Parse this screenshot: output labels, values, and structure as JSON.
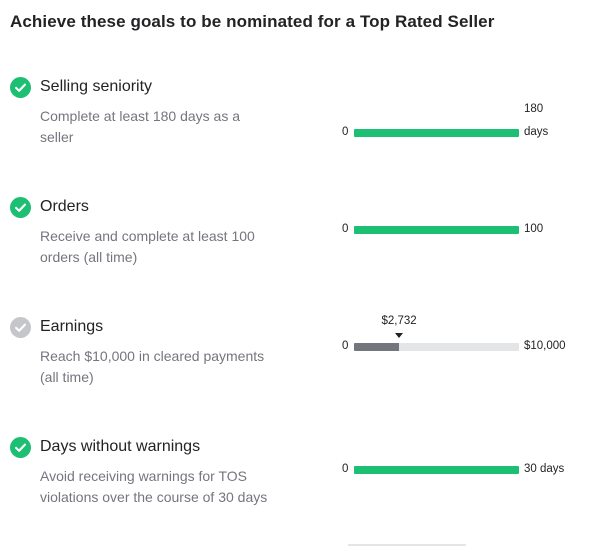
{
  "page": {
    "title": "Achieve these goals to be nominated for a Top Rated Seller"
  },
  "colors": {
    "achieved": "#1dbf73",
    "pending": "#c5c6c9",
    "pending_fill": "#74767e",
    "track": "#e4e5e7"
  },
  "goals": [
    {
      "name": "Selling seniority",
      "description": "Complete at least 180 days as a seller",
      "achieved": true,
      "check_icon": "check-circle-icon",
      "bar": {
        "start": "0",
        "end_value": "180",
        "end_unit": "days",
        "progress": 1.0
      }
    },
    {
      "name": "Orders",
      "description": "Receive and complete at least 100 orders (all time)",
      "achieved": true,
      "check_icon": "check-circle-icon",
      "bar": {
        "start": "0",
        "end": "100",
        "progress": 1.0
      }
    },
    {
      "name": "Earnings",
      "description": "Reach $10,000 in cleared payments (all time)",
      "achieved": false,
      "check_icon": "check-circle-icon",
      "bar": {
        "start": "0",
        "end": "$10,000",
        "marker": "$2,732",
        "progress": 0.2732
      }
    },
    {
      "name": "Days without warnings",
      "description": "Avoid receiving warnings for TOS violations over the course of 30 days",
      "achieved": true,
      "check_icon": "check-circle-icon",
      "bar": {
        "start": "0",
        "end": "30 days",
        "progress": 1.0
      }
    }
  ]
}
